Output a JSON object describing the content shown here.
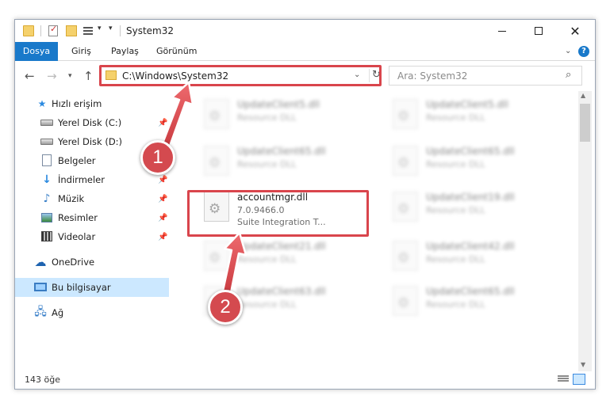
{
  "window": {
    "title": "System32",
    "controls": {
      "minimize": "─",
      "maximize": "",
      "close": "✕"
    }
  },
  "ribbon": {
    "tabs": [
      {
        "label": "Dosya",
        "active": true
      },
      {
        "label": "Giriş"
      },
      {
        "label": "Paylaş"
      },
      {
        "label": "Görünüm"
      }
    ],
    "help_icon": "?"
  },
  "nav": {
    "address": "C:\\Windows\\System32",
    "search_placeholder": "Ara: System32"
  },
  "sidebar": {
    "items": [
      {
        "label": "Hızlı erişim",
        "icon": "star-icon"
      },
      {
        "label": "Yerel Disk (C:)",
        "icon": "disk-icon",
        "pinned": true
      },
      {
        "label": "Yerel Disk (D:)",
        "icon": "disk-icon"
      },
      {
        "label": "Belgeler",
        "icon": "document-icon"
      },
      {
        "label": "İndirmeler",
        "icon": "download-icon",
        "pinned": true
      },
      {
        "label": "Müzik",
        "icon": "music-icon",
        "pinned": true
      },
      {
        "label": "Resimler",
        "icon": "pictures-icon",
        "pinned": true
      },
      {
        "label": "Videolar",
        "icon": "videos-icon",
        "pinned": true
      },
      {
        "label": "OneDrive",
        "icon": "cloud-icon"
      },
      {
        "label": "Bu bilgisayar",
        "icon": "computer-icon",
        "selected": true
      },
      {
        "label": "Ağ",
        "icon": "network-icon"
      }
    ]
  },
  "files": [
    {
      "name": "UpdateClient5.dll",
      "type": "Resource DLL"
    },
    {
      "name": "UpdateClient5.dll",
      "type": "Resource DLL"
    },
    {
      "name": "UpdateClient65.dll",
      "type": "Resource DLL"
    },
    {
      "name": "UpdateClient65.dll",
      "type": "Resource DLL"
    },
    {
      "name": "accountmgr.dll",
      "version": "7.0.9466.0",
      "description": "Suite Integration T...",
      "highlighted": true
    },
    {
      "name": "UpdateClient19.dll",
      "type": "Resource DLL"
    },
    {
      "name": "UpdateClient21.dll",
      "type": "Resource DLL"
    },
    {
      "name": "UpdateClient42.dll",
      "type": "Resource DLL"
    },
    {
      "name": "UpdateClient63.dll",
      "type": "Resource DLL"
    },
    {
      "name": "UpdateClient65.dll",
      "type": "Resource DLL"
    }
  ],
  "status": {
    "count": "143 öğe"
  },
  "callouts": {
    "step1": "1",
    "step2": "2"
  },
  "colors": {
    "accent": "#1979ca",
    "highlight": "#d9454c",
    "selected": "#cce8ff"
  }
}
